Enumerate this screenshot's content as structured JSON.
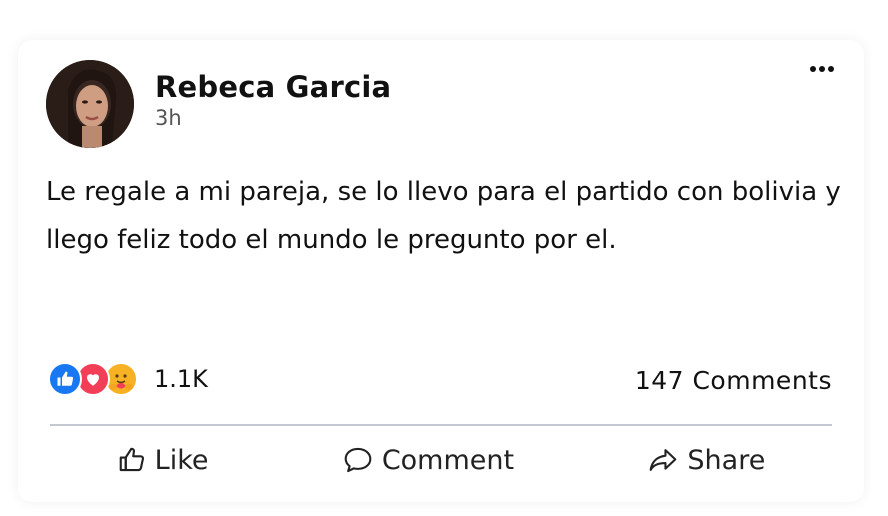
{
  "post": {
    "author_name": "Rebeca Garcia",
    "timestamp": "3h",
    "text": "Le regale a mi pareja, se lo llevo para el partido con bolivia y llego feliz todo el mundo le pregunto por el.",
    "reactions": {
      "icons": [
        "like-icon",
        "love-icon",
        "care-icon"
      ],
      "count": "1.1K"
    },
    "comments_count": "147 Comments"
  },
  "actions": {
    "like_label": "Like",
    "comment_label": "Comment",
    "share_label": "Share"
  },
  "colors": {
    "like_blue": "#1877f2",
    "love_red": "#f33e58",
    "care_yellow": "#f7b125",
    "divider": "#c3c8d2"
  }
}
